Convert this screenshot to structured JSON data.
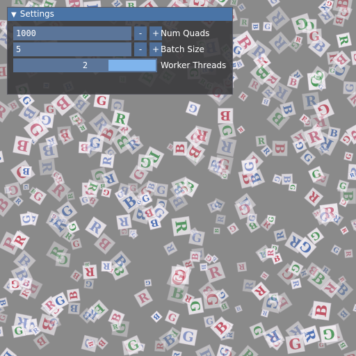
{
  "window": {
    "title": "Settings",
    "collapse_icon": "triangle-down-icon"
  },
  "controls": {
    "num_quads": {
      "value": "1000",
      "label": "Num Quads",
      "minus": "-",
      "plus": "+"
    },
    "batch_size": {
      "value": "5",
      "label": "Batch Size",
      "minus": "-",
      "plus": "+"
    },
    "worker_threads": {
      "value": "2",
      "label": "Worker Threads",
      "slider_fraction": 1.0
    }
  },
  "scene": {
    "quad_glyphs": [
      "R",
      "G",
      "B"
    ],
    "quad_colors": [
      "#c84a5e",
      "#4a9a5a",
      "#4a6fb8",
      "#d0708a",
      "#8a9ad0"
    ],
    "background": "#8a8a8a"
  }
}
